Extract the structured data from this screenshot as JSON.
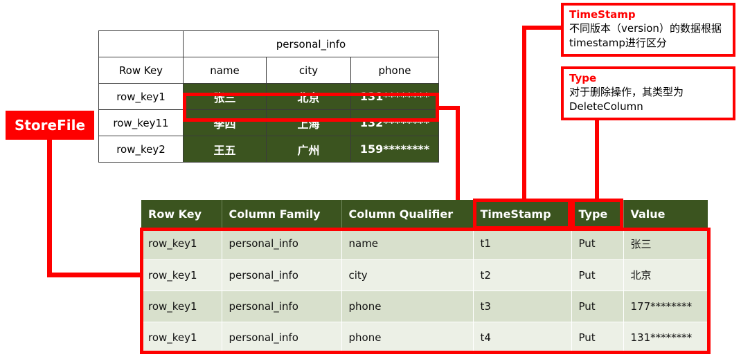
{
  "colors": {
    "red": "#fe0000",
    "dark_green": "#3b541f",
    "row_light": "#d8e0cc",
    "row_lighter": "#ecf0e6",
    "text": "#000000"
  },
  "storefile": {
    "label": "StoreFile"
  },
  "logical_table": {
    "column_family": "personal_info",
    "headers": [
      "Row Key",
      "name",
      "city",
      "phone"
    ],
    "rows": [
      {
        "row_key": "row_key1",
        "name": "张三",
        "city": "北京",
        "phone": "131********"
      },
      {
        "row_key": "row_key11",
        "name": "李四",
        "city": "上海",
        "phone": "132********"
      },
      {
        "row_key": "row_key2",
        "name": "王五",
        "city": "广州",
        "phone": "159********"
      }
    ]
  },
  "callouts": [
    {
      "title": "TimeStamp",
      "body": "不同版本（version）的数据根据timestamp进行区分"
    },
    {
      "title": "Type",
      "body": "对于删除操作，其类型为 DeleteColumn"
    }
  ],
  "storefile_table": {
    "headers": [
      "Row Key",
      "Column Family",
      "Column Qualifier",
      "TimeStamp",
      "Type",
      "Value"
    ],
    "rows": [
      {
        "row_key": "row_key1",
        "column_family": "personal_info",
        "column_qualifier": "name",
        "timestamp": "t1",
        "type": "Put",
        "value": "张三"
      },
      {
        "row_key": "row_key1",
        "column_family": "personal_info",
        "column_qualifier": "city",
        "timestamp": "t2",
        "type": "Put",
        "value": "北京"
      },
      {
        "row_key": "row_key1",
        "column_family": "personal_info",
        "column_qualifier": "phone",
        "timestamp": "t3",
        "type": "Put",
        "value": "177********"
      },
      {
        "row_key": "row_key1",
        "column_family": "personal_info",
        "column_qualifier": "phone",
        "timestamp": "t4",
        "type": "Put",
        "value": "131********"
      }
    ]
  }
}
